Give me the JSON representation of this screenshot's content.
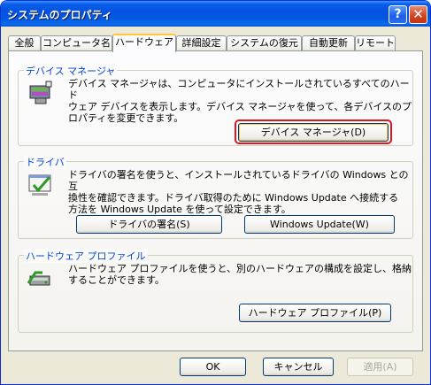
{
  "window": {
    "title": "システムのプロパティ",
    "help_symbol": "?",
    "close_symbol": "✕"
  },
  "tabs": [
    {
      "label": "全般"
    },
    {
      "label": "コンピュータ名"
    },
    {
      "label": "ハードウェア"
    },
    {
      "label": "詳細設定"
    },
    {
      "label": "システムの復元"
    },
    {
      "label": "自動更新"
    },
    {
      "label": "リモート"
    }
  ],
  "device_manager": {
    "label": "デバイス マネージャ",
    "text_lines": [
      "デバイス マネージャは、コンピュータにインストールされているすべてのハード",
      "ウェア デバイスを表示します。デバイス マネージャを使って、各デバイスのプ",
      "ロパティを変更できます。"
    ],
    "button": "デバイス マネージャ(D)"
  },
  "drivers": {
    "label": "ドライバ",
    "text_lines": [
      "ドライバの署名を使うと、インストールされているドライバの Windows との互",
      "換性を確認できます。ドライバ取得のために Windows Update へ接続する",
      "方法を Windows Update を使って設定できます。"
    ],
    "signing_button": "ドライバの署名(S)",
    "update_button": "Windows Update(W)"
  },
  "hardware_profiles": {
    "label": "ハードウェア プロファイル",
    "text_lines": [
      "ハードウェア プロファイルを使うと、別のハードウェアの構成を設定し、格納",
      "することができます。"
    ],
    "button": "ハードウェア プロファイル(P)"
  },
  "footer": {
    "ok": "OK",
    "cancel": "キャンセル",
    "apply": "適用(A)"
  },
  "colors": {
    "title_bar": "#0553e3",
    "group_label": "#0046d5",
    "highlight": "#e0161b"
  }
}
